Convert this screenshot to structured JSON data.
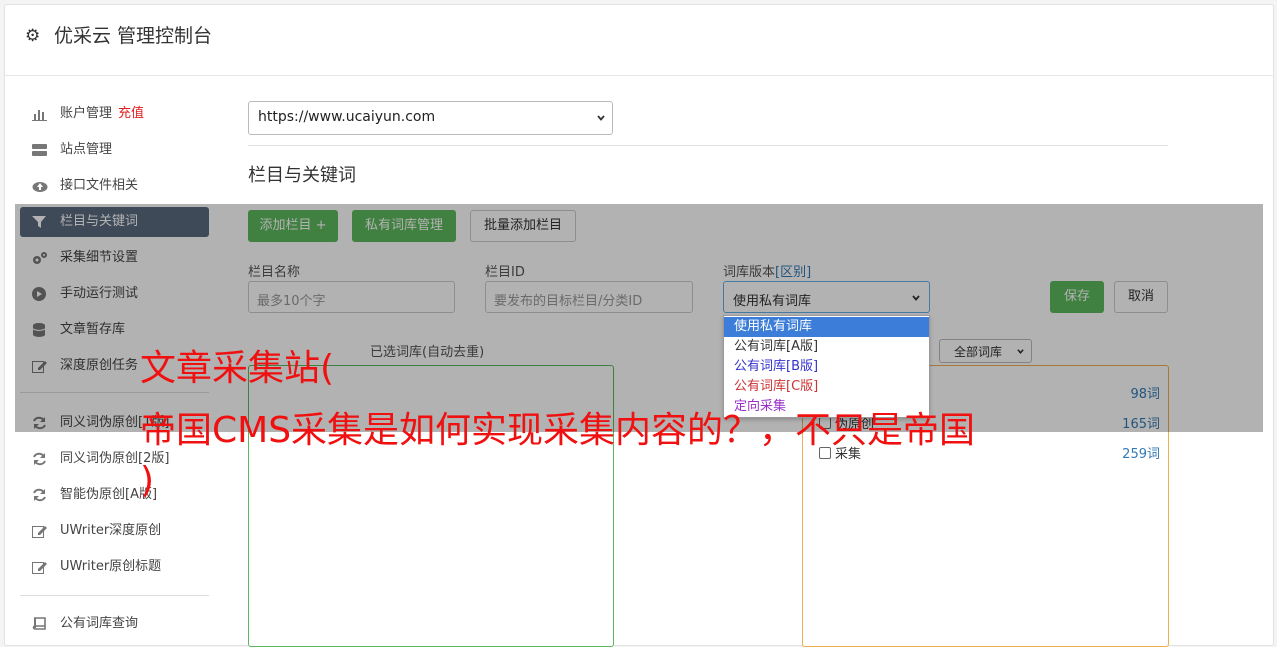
{
  "header": {
    "title": "优采云 管理控制台"
  },
  "sidebar": {
    "items": [
      {
        "label": "账户管理",
        "extra": "充值"
      },
      {
        "label": "站点管理"
      },
      {
        "label": "接口文件相关"
      },
      {
        "label": "栏目与关键词"
      },
      {
        "label": "采集细节设置"
      },
      {
        "label": "手动运行测试"
      },
      {
        "label": "文章暂存库"
      },
      {
        "label": "深度原创任务"
      },
      {
        "label": "同义词伪原创[1版]"
      },
      {
        "label": "同义词伪原创[2版]"
      },
      {
        "label": "智能伪原创[A版]"
      },
      {
        "label": "UWriter深度原创"
      },
      {
        "label": "UWriter原创标题"
      },
      {
        "label": "公有词库查询"
      }
    ]
  },
  "site_select": {
    "value": "https://www.ucaiyun.com"
  },
  "section_title": "栏目与关键词",
  "toolbar": {
    "add_column": "添加栏目 +",
    "private_lib": "私有词库管理",
    "batch_add": "批量添加栏目"
  },
  "form": {
    "name_label": "栏目名称",
    "name_placeholder": "最多10个字",
    "id_label": "栏目ID",
    "id_placeholder": "要发布的目标栏目/分类ID",
    "version_label": "词库版本",
    "version_link": "[区别]",
    "version_value": "使用私有词库",
    "save": "保存",
    "cancel": "取消"
  },
  "dropdown": {
    "options": [
      {
        "label": "使用私有词库",
        "color": "#ffffff"
      },
      {
        "label": "公有词库[A版]",
        "color": "#333333"
      },
      {
        "label": "公有词库[B版]",
        "color": "#3333cc"
      },
      {
        "label": "公有词库[C版]",
        "color": "#cc3333"
      },
      {
        "label": "定向采集",
        "color": "#9b30c8"
      }
    ]
  },
  "left_panel": {
    "title": "已选词库(自动去重)"
  },
  "right_panel": {
    "filter_value": "全部词库",
    "rows": [
      {
        "label": "",
        "count": "98词"
      },
      {
        "label": "伪原创",
        "count": "165词"
      },
      {
        "label": "采集",
        "count": "259词"
      }
    ]
  },
  "watermark": {
    "line1": "文章采集站(",
    "line2": "帝国CMS采集是如何实现采集内容的？，不只是帝国",
    "line3": ")"
  },
  "colors": {
    "accent_green": "#5cb85c",
    "active_item": "#5a6a7e",
    "watermark_red": "#f01010",
    "link_blue": "#337ab7"
  }
}
